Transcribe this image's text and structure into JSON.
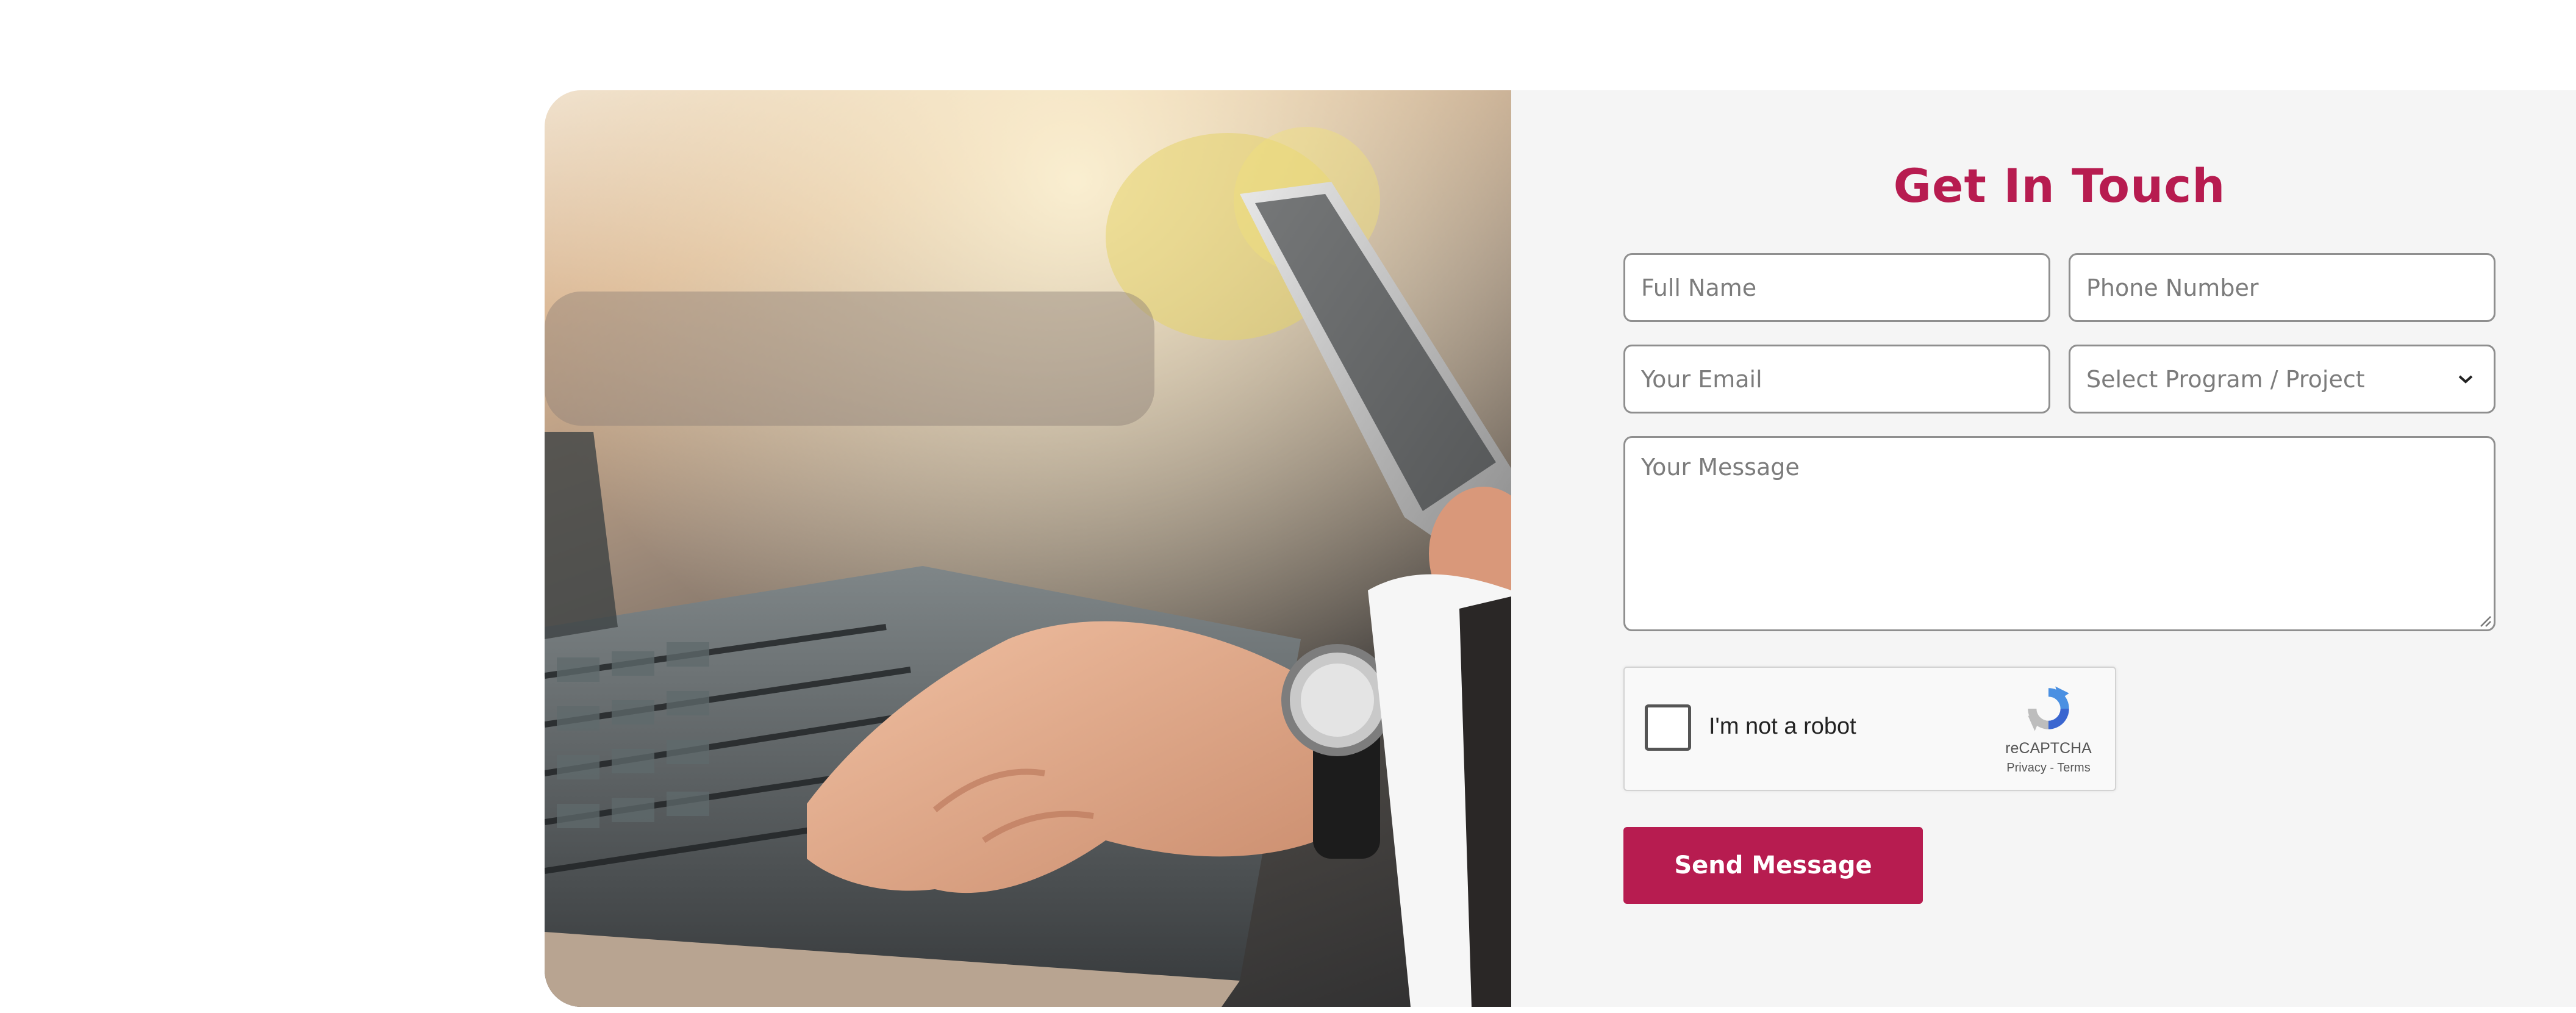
{
  "contact": {
    "title": "Get In Touch",
    "fields": {
      "full_name": {
        "placeholder": "Full Name",
        "value": ""
      },
      "phone": {
        "placeholder": "Phone Number",
        "value": ""
      },
      "email": {
        "placeholder": "Your Email",
        "value": ""
      },
      "program": {
        "selected": "Select Program / Project"
      },
      "message": {
        "placeholder": "Your Message",
        "value": ""
      }
    },
    "captcha": {
      "label": "I'm not a robot",
      "brand": "reCAPTCHA",
      "links": "Privacy - Terms",
      "checked": false
    },
    "submit_label": "Send Message"
  },
  "colors": {
    "accent": "#b71c50",
    "panel_background": "#f5f5f5",
    "field_border": "#8f8f8f"
  },
  "image": {
    "subject": "hand typing on laptop keyboard while holding a smartphone"
  }
}
